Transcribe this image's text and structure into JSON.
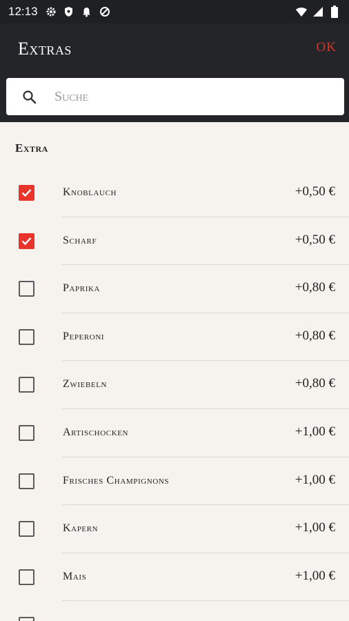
{
  "status_bar": {
    "time": "12:13",
    "left_icons": [
      "gear-icon",
      "shield-icon",
      "bell-icon",
      "sync-icon"
    ],
    "right_icons": [
      "wifi-icon",
      "signal-icon",
      "battery-icon"
    ]
  },
  "app_bar": {
    "title": "Extras",
    "ok_label": "OK"
  },
  "search": {
    "placeholder": "Suche",
    "value": ""
  },
  "section": {
    "header": "Extra"
  },
  "items": [
    {
      "label": "Knoblauch",
      "price": "+0,50 €",
      "checked": true
    },
    {
      "label": "Scharf",
      "price": "+0,50 €",
      "checked": true
    },
    {
      "label": "Paprika",
      "price": "+0,80 €",
      "checked": false
    },
    {
      "label": "Peperoni",
      "price": "+0,80 €",
      "checked": false
    },
    {
      "label": "Zwiebeln",
      "price": "+0,80 €",
      "checked": false
    },
    {
      "label": "Artischocken",
      "price": "+1,00 €",
      "checked": false
    },
    {
      "label": "Frisches Champignons",
      "price": "+1,00 €",
      "checked": false
    },
    {
      "label": "Kapern",
      "price": "+1,00 €",
      "checked": false
    },
    {
      "label": "Mais",
      "price": "+1,00 €",
      "checked": false
    },
    {
      "label": "",
      "price": "",
      "checked": false
    }
  ],
  "colors": {
    "accent": "#e8342a",
    "app_bar": "#242528",
    "ok": "#d6372b"
  }
}
